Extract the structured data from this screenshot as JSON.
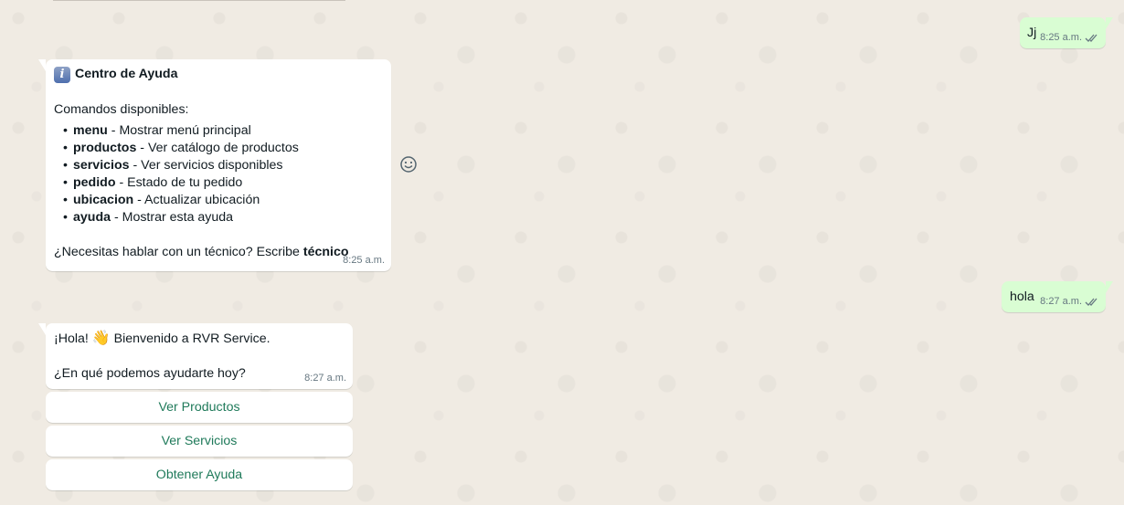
{
  "messages": {
    "out_1": {
      "text": "Jj",
      "time": "8:25 a.m.",
      "status": "read"
    },
    "help": {
      "icon": "info-icon",
      "title": "Centro de Ayuda",
      "subtitle": "Comandos disponibles:",
      "commands": [
        {
          "cmd": "menu",
          "desc": " - Mostrar menú principal"
        },
        {
          "cmd": "productos",
          "desc": " - Ver catálogo de productos"
        },
        {
          "cmd": "servicios",
          "desc": " - Ver servicios disponibles"
        },
        {
          "cmd": "pedido",
          "desc": " - Estado de tu pedido"
        },
        {
          "cmd": "ubicacion",
          "desc": " - Actualizar ubicación"
        },
        {
          "cmd": "ayuda",
          "desc": " - Mostrar esta ayuda"
        }
      ],
      "footer_text": "¿Necesitas hablar con un técnico? Escribe ",
      "footer_bold": "técnico",
      "time": "8:25 a.m."
    },
    "out_2": {
      "text": "hola",
      "time": "8:27 a.m.",
      "status": "read"
    },
    "welcome": {
      "greeting": "¡Hola! ",
      "emoji": "👋",
      "greeting_rest": " Bienvenido a RVR Service.",
      "question": "¿En qué podemos ayudarte hoy?",
      "time": "8:27 a.m."
    }
  },
  "quick_replies": [
    {
      "label": "Ver Productos"
    },
    {
      "label": "Ver Servicios"
    },
    {
      "label": "Obtener Ayuda"
    }
  ],
  "icons": {
    "reaction": "smiley-icon",
    "read_status": "double-check-icon"
  },
  "colors": {
    "background": "#efeae2",
    "incoming_bubble": "#ffffff",
    "outgoing_bubble": "#d9fdd3",
    "button_text": "#1f7a5a",
    "read_ticks": "#667781"
  }
}
